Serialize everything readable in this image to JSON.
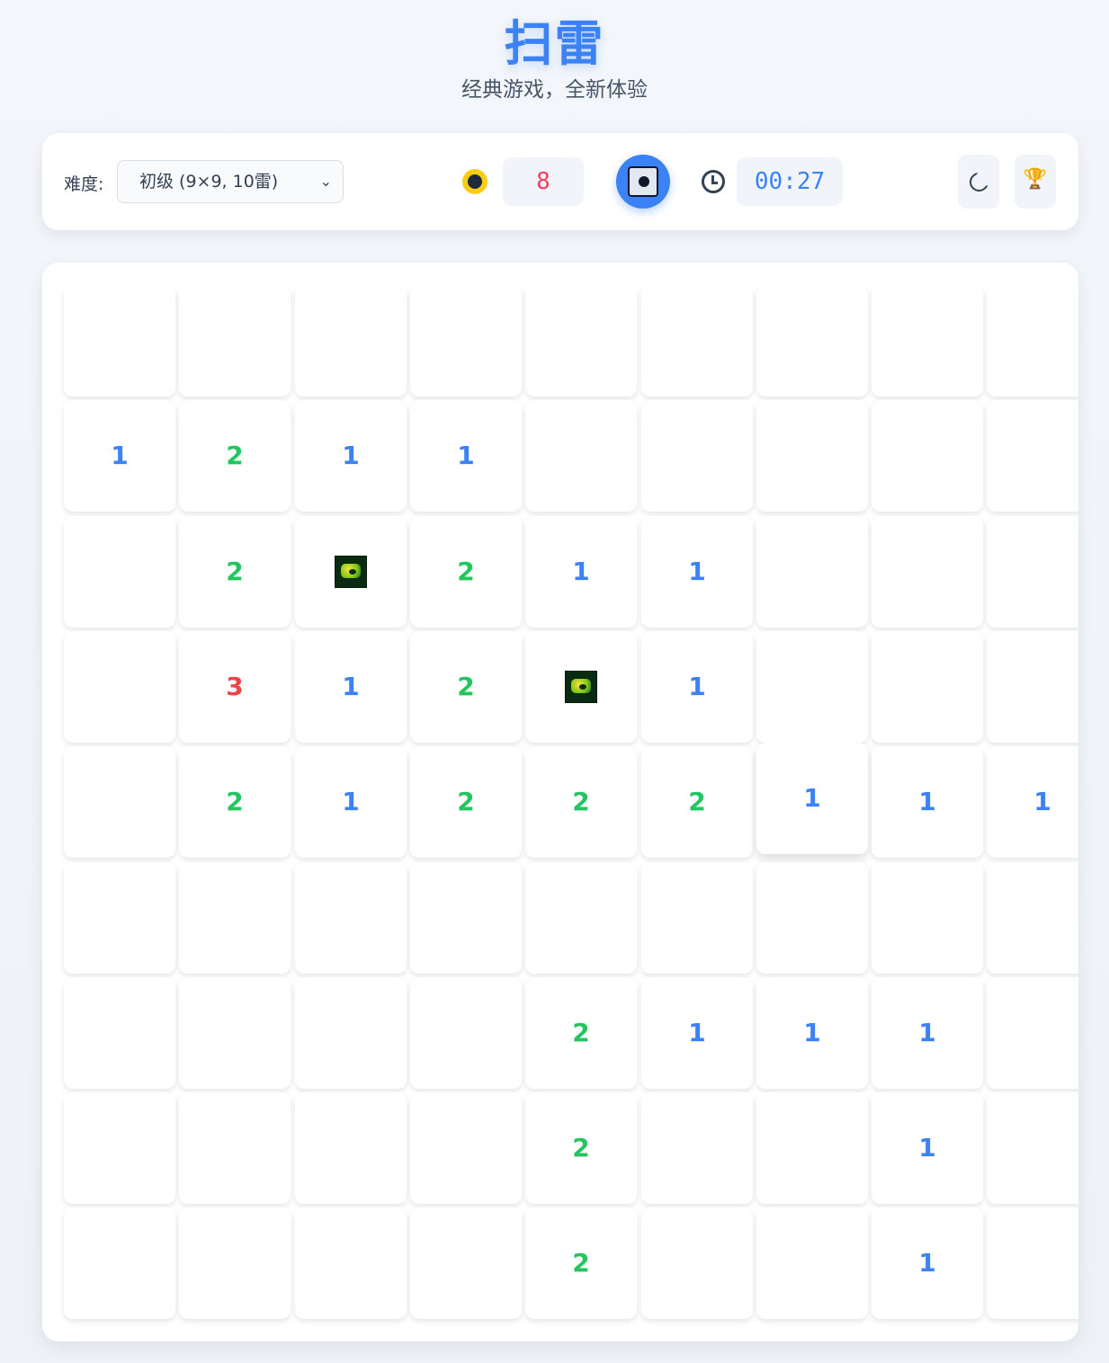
{
  "header": {
    "title": "扫雷",
    "subtitle": "经典游戏，全新体验"
  },
  "toolbar": {
    "difficulty_label": "难度:",
    "difficulty_value": "初级 (9×9, 10雷)",
    "mines_remaining": "8",
    "timer": "00:27"
  },
  "icons": {
    "mine": "mine-icon",
    "reset": "face-button-icon",
    "clock": "clock-icon",
    "theme": "moon-icon",
    "leaderboard": "trophy-icon"
  },
  "board": {
    "rows": 9,
    "cols": 9,
    "cells": [
      [
        "",
        "",
        "",
        "",
        "",
        "",
        "",
        "",
        ""
      ],
      [
        "1",
        "2",
        "1",
        "1",
        "",
        "",
        "",
        "",
        ""
      ],
      [
        "",
        "2",
        "mine",
        "2",
        "1",
        "1",
        "",
        "",
        ""
      ],
      [
        "",
        "3",
        "1",
        "2",
        "mine",
        "1",
        "",
        "",
        ""
      ],
      [
        "",
        "2",
        "1",
        "2",
        "2",
        "2",
        "1",
        "1",
        "1"
      ],
      [
        "",
        "",
        "",
        "",
        "",
        "",
        "",
        "",
        ""
      ],
      [
        "",
        "",
        "",
        "",
        "2",
        "1",
        "1",
        "1",
        ""
      ],
      [
        "",
        "",
        "",
        "",
        "2",
        "",
        "",
        "1",
        ""
      ],
      [
        "",
        "",
        "",
        "",
        "2",
        "",
        "",
        "1",
        ""
      ]
    ],
    "hovered_cell": {
      "row": 4,
      "col": 6
    }
  },
  "colors": {
    "accent": "#3b82f6",
    "number_1": "#3b82f6",
    "number_2": "#22c55e",
    "number_3": "#ef4444",
    "mine_counter": "#f43f5e"
  }
}
